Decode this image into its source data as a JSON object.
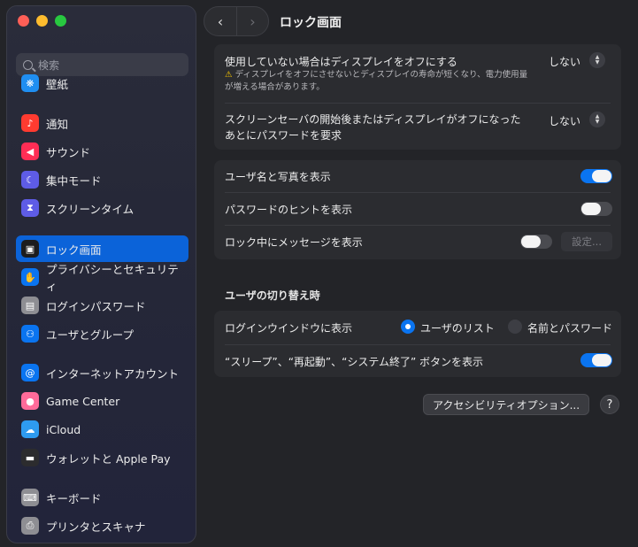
{
  "search": {
    "placeholder": "検索"
  },
  "sidebar": {
    "items": [
      {
        "label": "壁紙",
        "icon": "wallpaper-icon",
        "color": "#1f8ef1"
      },
      {
        "label": "通知",
        "icon": "bell-icon",
        "color": "#ff3b30"
      },
      {
        "label": "サウンド",
        "icon": "speaker-icon",
        "color": "#ff2d55"
      },
      {
        "label": "集中モード",
        "icon": "moon-icon",
        "color": "#5e5ce6"
      },
      {
        "label": "スクリーンタイム",
        "icon": "hourglass-icon",
        "color": "#5e5ce6"
      },
      {
        "label": "ロック画面",
        "icon": "lock-screen-icon",
        "color": "#1c1c1e",
        "active": true
      },
      {
        "label": "プライバシーとセキュリティ",
        "icon": "hand-icon",
        "color": "#0a74f0"
      },
      {
        "label": "ログインパスワード",
        "icon": "padlock-icon",
        "color": "#8e8e93"
      },
      {
        "label": "ユーザとグループ",
        "icon": "users-icon",
        "color": "#0a74f0"
      },
      {
        "label": "インターネットアカウント",
        "icon": "at-icon",
        "color": "#0a74f0"
      },
      {
        "label": "Game Center",
        "icon": "game-center-icon",
        "color": "#ff6b9a"
      },
      {
        "label": "iCloud",
        "icon": "cloud-icon",
        "color": "#2e9bf0"
      },
      {
        "label": "ウォレットと Apple Pay",
        "icon": "wallet-icon",
        "color": "#2c2c2e"
      },
      {
        "label": "キーボード",
        "icon": "keyboard-icon",
        "color": "#8e8e93"
      },
      {
        "label": "プリンタとスキャナ",
        "icon": "printer-icon",
        "color": "#8e8e93"
      }
    ]
  },
  "header": {
    "title": "ロック画面",
    "back": "‹",
    "forward": "›"
  },
  "display": {
    "screen_off_label": "使用していない場合はディスプレイをオフにする",
    "screen_off_warning": "ディスプレイをオフにさせないとディスプレイの寿命が短くなり、電力使用量が増える場合があります。",
    "screen_off_value": "しない",
    "password_label_1": "スクリーンセーバの開始後またはディスプレイがオフになった",
    "password_label_2": "あとにパスワードを要求",
    "password_value": "しない"
  },
  "options": {
    "show_user": {
      "label": "ユーザ名と写真を表示",
      "on": true
    },
    "show_hint": {
      "label": "パスワードのヒントを表示",
      "on": false
    },
    "show_message": {
      "label": "ロック中にメッセージを表示",
      "on": false,
      "button": "設定..."
    }
  },
  "switching": {
    "title": "ユーザの切り替え時",
    "login_window_label": "ログインウインドウに表示",
    "option_list": "ユーザのリスト",
    "option_name": "名前とパスワード",
    "buttons_label": "“スリープ”、“再起動”、“システム終了” ボタンを表示",
    "buttons_on": true
  },
  "footer": {
    "accessibility": "アクセシビリティオプション...",
    "help": "?"
  }
}
